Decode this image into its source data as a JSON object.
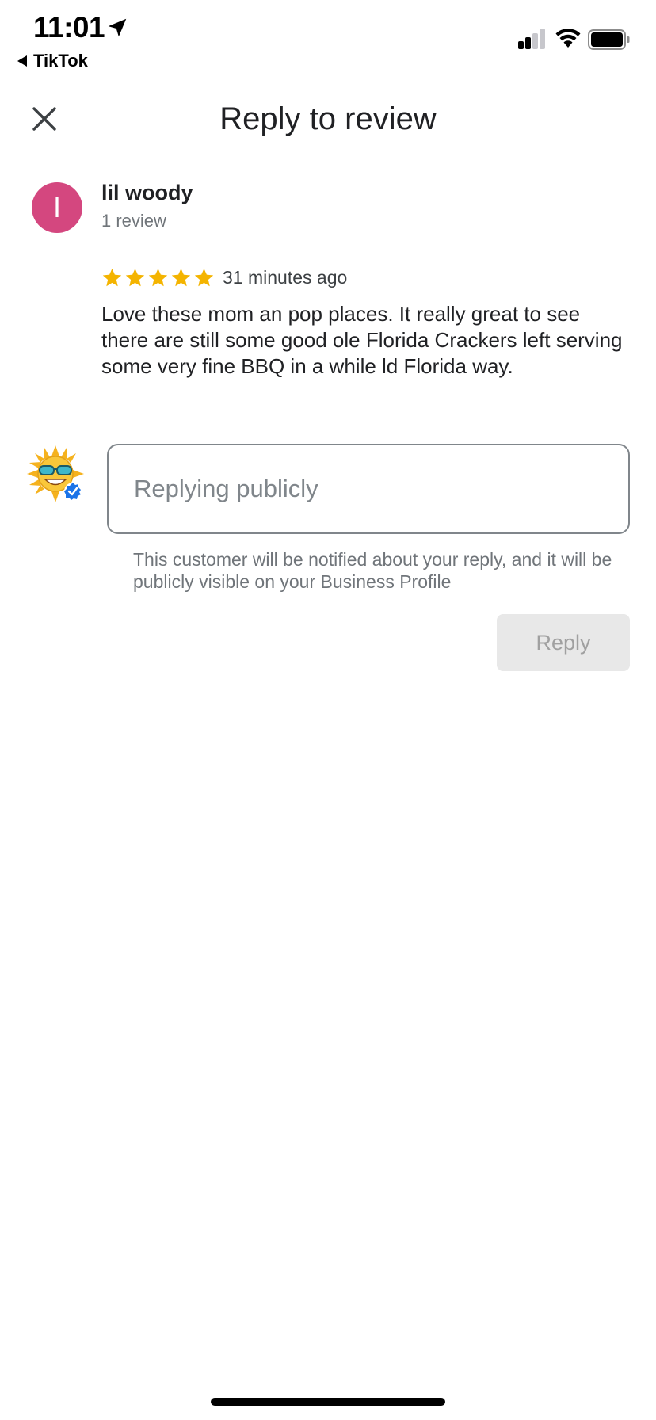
{
  "status_bar": {
    "time": "11:01",
    "back_app": "TikTok"
  },
  "header": {
    "title": "Reply to review"
  },
  "review": {
    "avatar_letter": "l",
    "avatar_color": "#d4477f",
    "reviewer_name": "lil woody",
    "review_count": "1 review",
    "rating": 5,
    "max_rating": 5,
    "time_ago": "31 minutes ago",
    "text": "Love these mom an pop places. It really great to see there are still some good ole Florida Crackers left serving some very fine BBQ in a while ld Florida way."
  },
  "reply": {
    "placeholder": "Replying publicly",
    "value": "",
    "notice": "This customer will be notified about your reply, and it will be publicly visible on your Business Profile",
    "button_label": "Reply"
  },
  "icons": {
    "close": "close-icon",
    "star": "star-icon",
    "verified": "verified-badge-icon"
  },
  "colors": {
    "star": "#f4b400",
    "verified": "#1a73e8",
    "button_disabled_bg": "#e8e8e8"
  }
}
